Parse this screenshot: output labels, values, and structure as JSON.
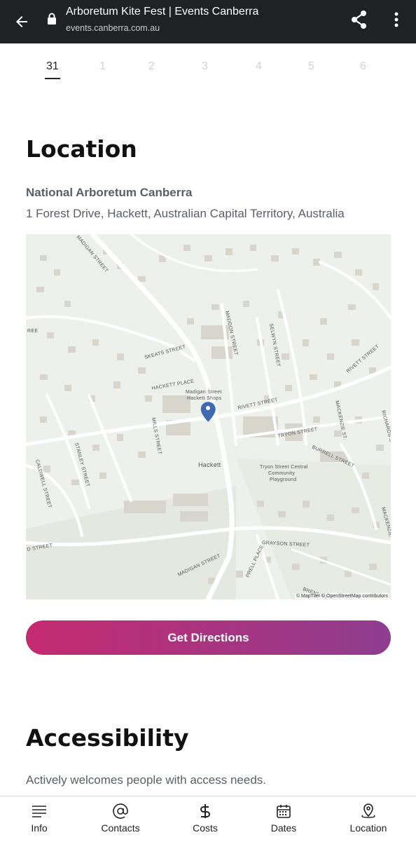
{
  "browser": {
    "title": "Arboretum Kite Fest | Events Canberra",
    "url": "events.canberra.com.au",
    "icons": [
      "back-arrow-icon",
      "lock-icon",
      "share-icon",
      "more-vert-icon"
    ]
  },
  "dates": [
    "31",
    "1",
    "2",
    "3",
    "4",
    "5",
    "6"
  ],
  "selected_date": "31",
  "location": {
    "heading": "Location",
    "venue": "National Arboretum Canberra",
    "address": "1 Forest Drive, Hackett, Australian Capital Territory, Australia",
    "map": {
      "attribution": "© MapTiler © OpenStreetMap contributors",
      "labels": {
        "madigan_top": "MADIGAN STREET",
        "skeats": "SKEATS STREET",
        "hackett_place": "HACKETT PLACE",
        "shops1": "Madigan Street",
        "shops2": "Hackett Shops",
        "maddon": "MADDON STREET",
        "selwyn": "SELWYN STREET",
        "rivett1": "RIVETT STREET",
        "rivett2": "RIVETT STREET",
        "mills": "MILLS STREET",
        "stanley": "STANLEY STREET",
        "caldwell": "CALDWELL STREET",
        "tryon": "TRYON STREET",
        "burrell": "BURRELL STREET",
        "mackenzie": "MACKENZIE ST.",
        "richards": "RICHARDS S",
        "hackett": "Hackett",
        "playground1": "Tryon Street Central",
        "playground2": "Community",
        "playground3": "Playground",
        "grayson": "GRAYSON STREET",
        "madigan_bottom": "MADIGAN STREET",
        "prell": "PRELL PLACE",
        "brennan": "BRENNAN",
        "street_left": "D STREET",
        "mackenzie2": "MACKENZIE",
        "ree": "REE"
      },
      "marker_color": "#3d6ab3"
    },
    "directions_button": "Get Directions"
  },
  "accessibility": {
    "heading": "Accessibility",
    "text": "Actively welcomes people with access needs."
  },
  "bottom_nav": [
    {
      "label": "Info",
      "icon": "menu-lines-icon"
    },
    {
      "label": "Contacts",
      "icon": "at-sign-icon"
    },
    {
      "label": "Costs",
      "icon": "dollar-icon"
    },
    {
      "label": "Dates",
      "icon": "calendar-icon"
    },
    {
      "label": "Location",
      "icon": "map-pin-icon"
    }
  ],
  "colors": {
    "topbar": "#202124",
    "button_start": "#c42a70",
    "button_end": "#8e3d8f"
  }
}
